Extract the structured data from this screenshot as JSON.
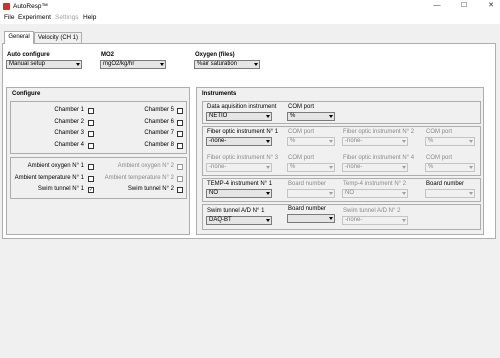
{
  "window": {
    "title": "AutoResp™",
    "minimize_glyph": "—",
    "maximize_glyph": "☐",
    "close_glyph": "✕"
  },
  "menu": {
    "file": "File",
    "experiment": "Experiment",
    "settings": "Settings",
    "help": "Help"
  },
  "tabs": {
    "general": "General",
    "velocity": "Velocity (CH 1)"
  },
  "top": {
    "auto_configure_label": "Auto configure",
    "auto_configure_value": "Manual setup",
    "mo2_label": "MO2",
    "mo2_value": "mgO2/kg/hr",
    "oxygen_label": "Oxygen (files)",
    "oxygen_value": "%air saturation"
  },
  "configure": {
    "title": "Configure",
    "chambers": [
      "Chamber 1",
      "Chamber 2",
      "Chamber 3",
      "Chamber 4",
      "Chamber 5",
      "Chamber 6",
      "Chamber 7",
      "Chamber 8"
    ],
    "ambient_oxygen_1": "Ambient oxygen N° 1",
    "ambient_oxygen_2": "Ambient oxygen N° 2",
    "ambient_temp_1": "Ambient temperature N° 1",
    "ambient_temp_2": "Ambient temperature N° 2",
    "swim_tunnel_1": "Swim tunnel N° 1",
    "swim_tunnel_2": "Swim tunnel N° 2",
    "check_mark": "✓"
  },
  "instruments": {
    "title": "Instruments",
    "daq_label": "Data aquisition instrument",
    "daq_value": "NETIO",
    "com_port": "COM port",
    "com_value": "%",
    "fo1_label": "Fiber optic instrument N° 1",
    "fo2_label": "Fiber optic instrument N° 2",
    "fo3_label": "Fiber optic instrument N° 3",
    "fo4_label": "Fiber optic instrument N° 4",
    "none_value": "-none-",
    "temp1_label": "TEMP-4 instrument N° 1",
    "temp2_label": "Temp-4 instrument N° 2",
    "board_number": "Board number",
    "no_value": "NO",
    "swim1_label": "Swim tunnel A/D N° 1",
    "swim1_value": "DAQ-BT",
    "swim2_label": "Swim tunnel A/D N° 2"
  }
}
